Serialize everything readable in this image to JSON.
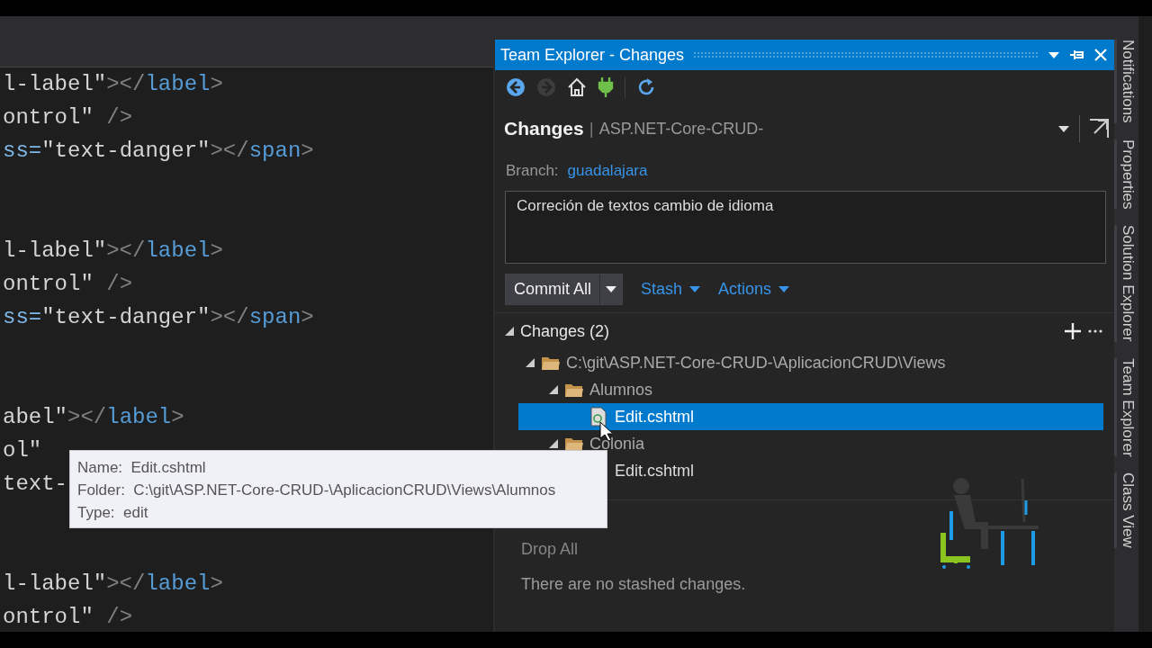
{
  "editor": {
    "lines": [
      {
        "kind": "code",
        "segments": [
          {
            "text": "l-label\"",
            "kind": "value"
          },
          {
            "text": "></",
            "kind": "punct"
          },
          {
            "text": "label",
            "kind": "tag"
          },
          {
            "text": ">",
            "kind": "punct"
          }
        ]
      },
      {
        "kind": "code",
        "segments": [
          {
            "text": "ontrol\"",
            "kind": "value"
          },
          {
            "text": " />",
            "kind": "punct"
          }
        ]
      },
      {
        "kind": "code",
        "segments": [
          {
            "text": "ss=",
            "kind": "attr"
          },
          {
            "text": "\"text-danger\"",
            "kind": "value"
          },
          {
            "text": "></",
            "kind": "punct"
          },
          {
            "text": "span",
            "kind": "tag"
          },
          {
            "text": ">",
            "kind": "punct"
          }
        ]
      },
      {
        "kind": "blank"
      },
      {
        "kind": "blank"
      },
      {
        "kind": "code",
        "segments": [
          {
            "text": "l-label\"",
            "kind": "value"
          },
          {
            "text": "></",
            "kind": "punct"
          },
          {
            "text": "label",
            "kind": "tag"
          },
          {
            "text": ">",
            "kind": "punct"
          }
        ]
      },
      {
        "kind": "code",
        "segments": [
          {
            "text": "ontrol\"",
            "kind": "value"
          },
          {
            "text": " />",
            "kind": "punct"
          }
        ]
      },
      {
        "kind": "code",
        "segments": [
          {
            "text": "ss=",
            "kind": "attr"
          },
          {
            "text": "\"text-danger\"",
            "kind": "value"
          },
          {
            "text": "></",
            "kind": "punct"
          },
          {
            "text": "span",
            "kind": "tag"
          },
          {
            "text": ">",
            "kind": "punct"
          }
        ]
      },
      {
        "kind": "blank"
      },
      {
        "kind": "blank"
      },
      {
        "kind": "code",
        "segments": [
          {
            "text": "abel\"",
            "kind": "value"
          },
          {
            "text": "></",
            "kind": "punct"
          },
          {
            "text": "label",
            "kind": "tag"
          },
          {
            "text": ">",
            "kind": "punct"
          }
        ]
      },
      {
        "kind": "code",
        "segments": [
          {
            "text": "ol\"",
            "kind": "value"
          }
        ]
      },
      {
        "kind": "code",
        "segments": [
          {
            "text": "text-",
            "kind": "value"
          }
        ]
      },
      {
        "kind": "blank"
      },
      {
        "kind": "blank"
      },
      {
        "kind": "code",
        "segments": [
          {
            "text": "l-label\"",
            "kind": "value"
          },
          {
            "text": "></",
            "kind": "punct"
          },
          {
            "text": "label",
            "kind": "tag"
          },
          {
            "text": ">",
            "kind": "punct"
          }
        ]
      },
      {
        "kind": "code",
        "segments": [
          {
            "text": "ontrol\"",
            "kind": "value"
          },
          {
            "text": " />",
            "kind": "punct"
          }
        ]
      }
    ]
  },
  "team_explorer": {
    "title": "Team Explorer - Changes",
    "header": {
      "title": "Changes",
      "separator": "|",
      "repository": "ASP.NET-Core-CRUD-"
    },
    "branch": {
      "label": "Branch:",
      "value": "guadalajara"
    },
    "commit_message": {
      "value": "Correción de textos cambio de idioma"
    },
    "commit_button": "Commit All",
    "links": [
      "Stash",
      "Actions"
    ],
    "changes": {
      "title": "Changes (2)",
      "expanded": true,
      "tree": [
        {
          "label": "C:\\git\\ASP.NET-Core-CRUD-\\AplicacionCRUD\\Views",
          "kind": "folder",
          "expanded": true,
          "selected": false,
          "children": [
            {
              "label": "Alumnos",
              "kind": "folder",
              "expanded": true,
              "selected": false,
              "children": [
                {
                  "label": "Edit.cshtml",
                  "kind": "file",
                  "icon_shown": true,
                  "selected": true
                }
              ]
            },
            {
              "label": "Colonia",
              "kind": "folder",
              "expanded": true,
              "selected": false,
              "children": [
                {
                  "label": "Edit.cshtml",
                  "kind": "file",
                  "icon_shown": false,
                  "selected": false
                }
              ]
            }
          ]
        }
      ]
    },
    "stashes": {
      "drop_all": {
        "label": "Drop All",
        "disabled": true
      },
      "message": "There are no stashed changes."
    }
  },
  "side_tabs": [
    {
      "label": "Notifications"
    },
    {
      "label": "Properties"
    },
    {
      "label": "Solution Explorer"
    },
    {
      "label": "Team Explorer"
    },
    {
      "label": "Class View"
    }
  ],
  "tooltip": {
    "rows": [
      {
        "label": "Name:",
        "value": "Edit.cshtml"
      },
      {
        "label": "Folder:",
        "value": "C:\\git\\ASP.NET-Core-CRUD-\\AplicacionCRUD\\Views\\Alumnos"
      },
      {
        "label": "Type:",
        "value": "edit"
      }
    ]
  }
}
